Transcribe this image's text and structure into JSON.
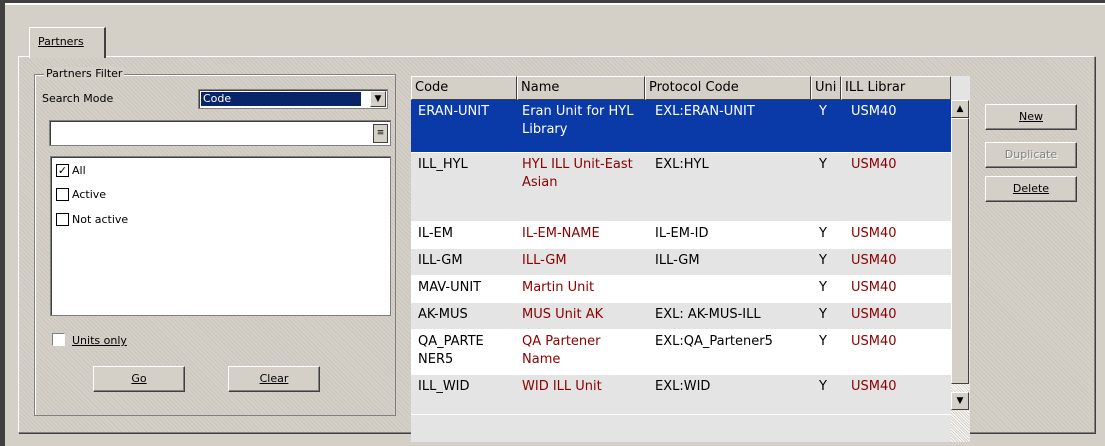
{
  "tab": {
    "label": "Partners"
  },
  "filter": {
    "title": "Partners Filter",
    "search_mode_label": "Search Mode",
    "search_mode_value": "Code",
    "search_text": "",
    "status_options": [
      {
        "label": "All",
        "checked": true
      },
      {
        "label": "Active",
        "checked": false
      },
      {
        "label": "Not active",
        "checked": false
      }
    ],
    "units_only_label": "Units only",
    "units_only_checked": false,
    "go_label": "Go",
    "clear_label": "Clear"
  },
  "grid": {
    "columns": [
      "Code",
      "Name",
      "Protocol Code",
      "Uni",
      "ILL Librar"
    ],
    "rows": [
      {
        "code": "ERAN-UNIT",
        "name": "Eran Unit for HYL Library",
        "protocol": "EXL:ERAN-UNIT",
        "unit": "Y",
        "library": "USM40",
        "selected": true
      },
      {
        "code": "ILL_HYL",
        "name": "HYL ILL Unit-East Asian",
        "protocol": "EXL:HYL",
        "unit": "Y",
        "library": "USM40"
      },
      {
        "code": "IL-EM",
        "name": "IL-EM-NAME",
        "protocol": "IL-EM-ID",
        "unit": "Y",
        "library": "USM40"
      },
      {
        "code": "ILL-GM",
        "name": "ILL-GM",
        "protocol": "ILL-GM",
        "unit": "Y",
        "library": "USM40"
      },
      {
        "code": "MAV-UNIT",
        "name": "Martin Unit",
        "protocol": "",
        "unit": "Y",
        "library": "USM40"
      },
      {
        "code": "AK-MUS",
        "name": "MUS Unit AK",
        "protocol": "EXL: AK-MUS-ILL",
        "unit": "Y",
        "library": "USM40"
      },
      {
        "code": "QA_PARTE NER5",
        "name": "QA Partener Name",
        "protocol": "EXL:QA_Partener5",
        "unit": "Y",
        "library": "USM40"
      },
      {
        "code": "ILL_WID",
        "name": "WID ILL Unit",
        "protocol": "EXL:WID",
        "unit": "Y",
        "library": "USM40"
      }
    ]
  },
  "actions": {
    "new_label": "New",
    "duplicate_label": "Duplicate",
    "delete_label": "Delete"
  }
}
